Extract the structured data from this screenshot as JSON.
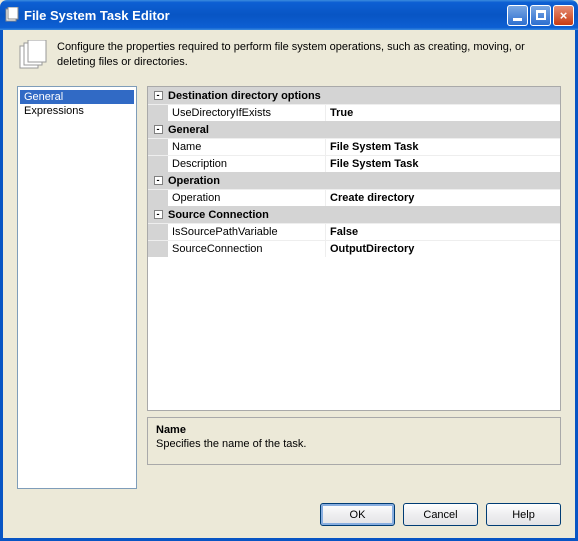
{
  "window": {
    "title": "File System Task Editor"
  },
  "header": {
    "description": "Configure the properties required to perform file system operations, such as creating, moving, or deleting files or directories."
  },
  "nav": {
    "items": [
      "General",
      "Expressions"
    ],
    "selected": 0
  },
  "grid": {
    "categories": [
      {
        "name": "Destination directory options",
        "rows": [
          {
            "name": "UseDirectoryIfExists",
            "value": "True"
          }
        ]
      },
      {
        "name": "General",
        "rows": [
          {
            "name": "Name",
            "value": "File System Task"
          },
          {
            "name": "Description",
            "value": "File System Task"
          }
        ]
      },
      {
        "name": "Operation",
        "rows": [
          {
            "name": "Operation",
            "value": "Create directory"
          }
        ]
      },
      {
        "name": "Source Connection",
        "rows": [
          {
            "name": "IsSourcePathVariable",
            "value": "False"
          },
          {
            "name": "SourceConnection",
            "value": "OutputDirectory"
          }
        ]
      }
    ]
  },
  "description": {
    "title": "Name",
    "text": "Specifies the name of the task."
  },
  "buttons": {
    "ok": "OK",
    "cancel": "Cancel",
    "help": "Help"
  },
  "glyphs": {
    "collapse": "-"
  }
}
